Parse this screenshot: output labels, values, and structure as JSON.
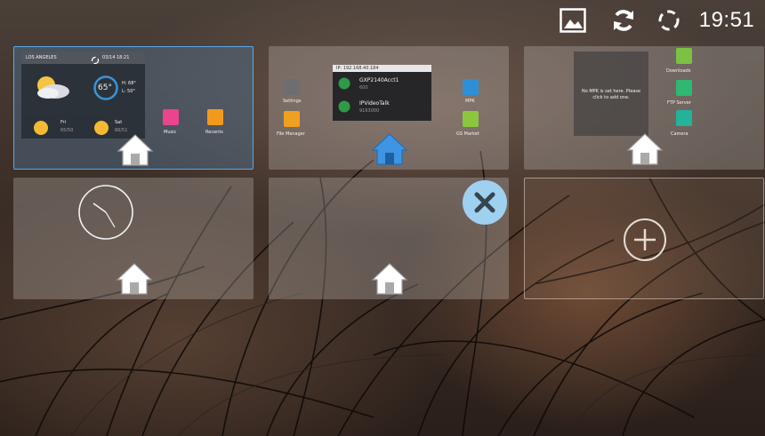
{
  "status_bar": {
    "icons": [
      "image-icon",
      "sync-icon",
      "loading-icon"
    ],
    "time": "19:51"
  },
  "screens": [
    {
      "selected": true,
      "weather": {
        "city": "LOS ANGELES",
        "date": "03/14 18:21",
        "temp": "65°",
        "high": "H: 68°",
        "low": "L: 50°",
        "day1": "Fri",
        "day1_range": "65/50",
        "day2": "Sat",
        "day2_range": "66/51"
      },
      "apps": [
        {
          "label": "Music",
          "color": "#e9448c"
        },
        {
          "label": "Recents",
          "color": "#f29a1d"
        }
      ]
    },
    {
      "selected": false,
      "sip": {
        "header": "IP: 192.168.40.184",
        "account1_name": "GXP2140Acct1",
        "account1_num": "600",
        "account2_name": "IPVideoTalk",
        "account2_num": "9163000"
      },
      "apps_left": [
        {
          "label": "Settings",
          "color": "#6e6e6e"
        },
        {
          "label": "File Manager",
          "color": "#f0a020"
        }
      ],
      "apps_right": [
        {
          "label": "MPK",
          "color": "#2f8fd6"
        },
        {
          "label": "GS Market",
          "color": "#8cc63f"
        }
      ]
    },
    {
      "selected": false,
      "note": "No MPK is set here. Please click to add one.",
      "apps": [
        {
          "label": "Downloads",
          "color": "#7cc142"
        },
        {
          "label": "FTP Server",
          "color": "#2eb872"
        },
        {
          "label": "Camera",
          "color": "#22b39a"
        }
      ]
    },
    {
      "selected": false,
      "widget": "analog-clock"
    },
    {
      "selected": false,
      "widget": "empty",
      "remove_button": "close-icon"
    },
    {
      "add_button": "plus-icon"
    }
  ]
}
